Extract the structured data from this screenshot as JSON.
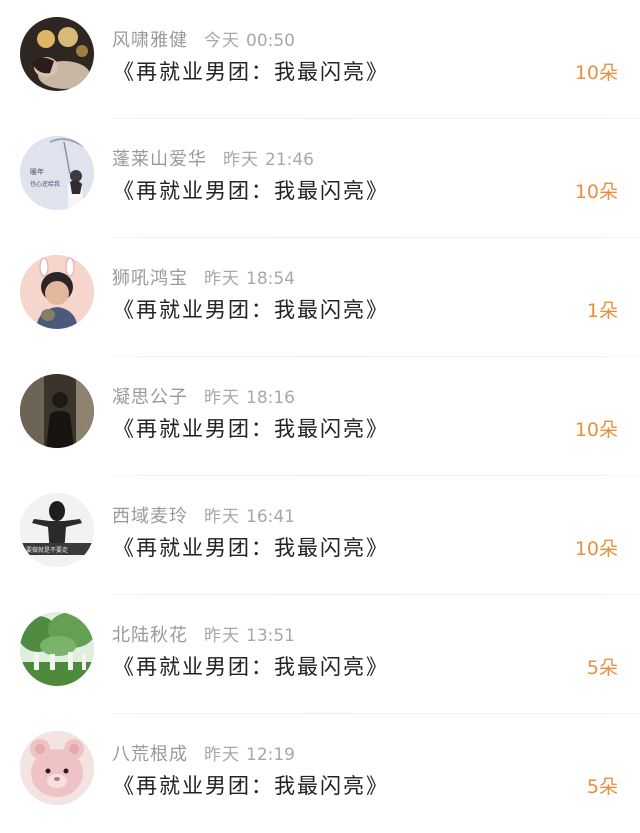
{
  "messages": [
    {
      "name": "风啸雅健",
      "day": "今天",
      "time": "00:50",
      "text": "《再就业男团：我最闪亮》",
      "count": "10朵",
      "avatar_icon": "avatar-woman-bokeh",
      "avatar_colors": [
        "#3a2a22",
        "#e8c27a"
      ]
    },
    {
      "name": "蓬莱山爱华",
      "day": "昨天",
      "time": "21:46",
      "text": "《再就业男团：我最闪亮》",
      "count": "10朵",
      "avatar_icon": "avatar-girl-umbrella",
      "avatar_colors": [
        "#dfe3ee",
        "#5a5f7a"
      ],
      "avatar_caption": "暖年 也心还给我"
    },
    {
      "name": "狮吼鸿宝",
      "day": "昨天",
      "time": "18:54",
      "text": "《再就业男团：我最闪亮》",
      "count": "1朵",
      "avatar_icon": "avatar-boy-bunny-ears",
      "avatar_colors": [
        "#f5d2c8",
        "#3a3a46"
      ]
    },
    {
      "name": "凝思公子",
      "day": "昨天",
      "time": "18:16",
      "text": "《再就业男团：我最闪亮》",
      "count": "10朵",
      "avatar_icon": "avatar-man-dark",
      "avatar_colors": [
        "#3b342c",
        "#8e8170"
      ]
    },
    {
      "name": "西域麦玲",
      "day": "昨天",
      "time": "16:41",
      "text": "《再就业男团：我最闪亮》",
      "count": "10朵",
      "avatar_icon": "avatar-woman-bw",
      "avatar_colors": [
        "#f2f2f2",
        "#1e1e1e"
      ],
      "avatar_caption": "要做就是不要走"
    },
    {
      "name": "北陆秋花",
      "day": "昨天",
      "time": "13:51",
      "text": "《再就业男团：我最闪亮》",
      "count": "5朵",
      "avatar_icon": "avatar-park-trees",
      "avatar_colors": [
        "#5f9a4e",
        "#dfeede"
      ]
    },
    {
      "name": "八荒根成",
      "day": "昨天",
      "time": "12:19",
      "text": "《再就业男团：我最闪亮》",
      "count": "5朵",
      "avatar_icon": "avatar-pink-teddy-bear",
      "avatar_colors": [
        "#efc3c6",
        "#b5787d"
      ]
    }
  ],
  "accent_color": "#e8903e"
}
